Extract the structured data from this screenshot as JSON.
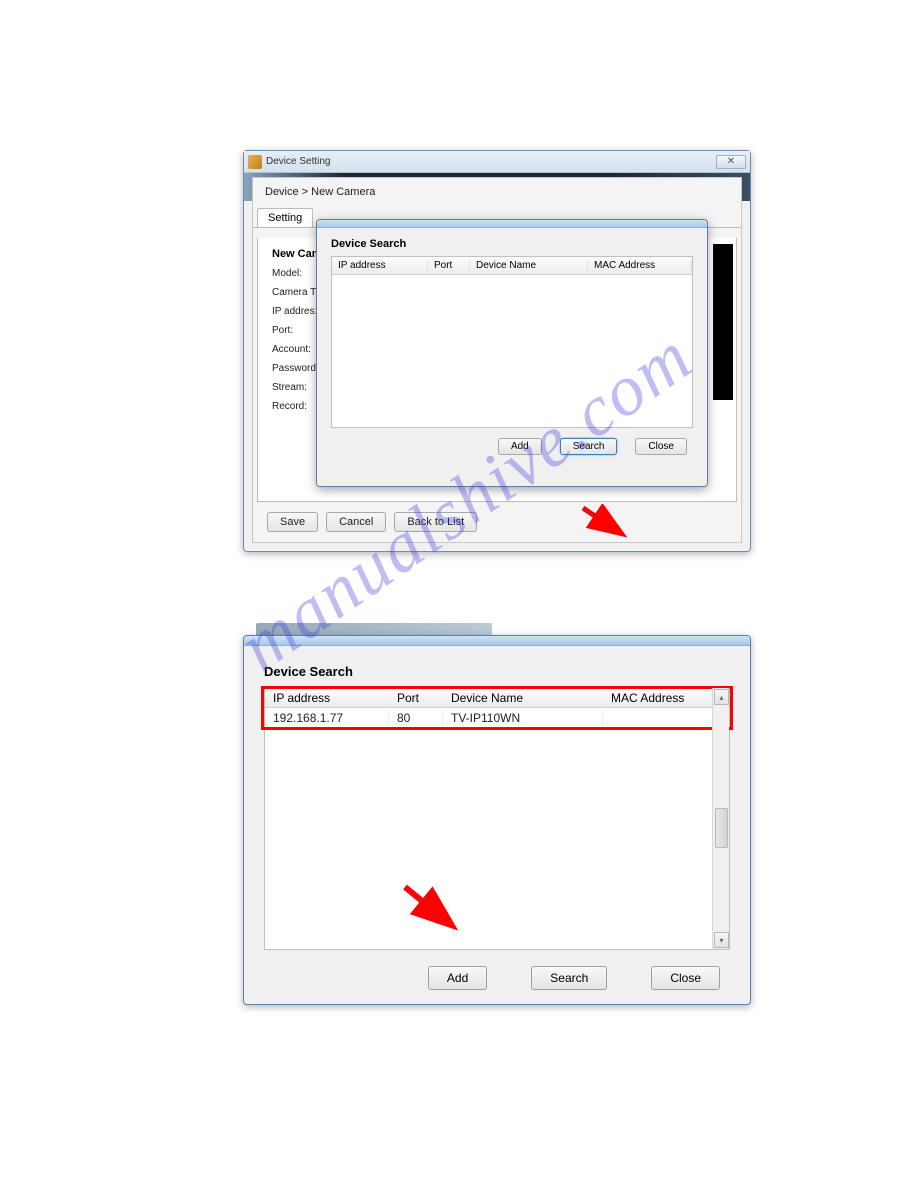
{
  "watermark": "manualshive.com",
  "win1": {
    "title": "Device Setting",
    "breadcrumb": "Device > New Camera",
    "tab": "Setting",
    "section": "New Cam",
    "labels": {
      "model": "Model:",
      "camera": "Camera T",
      "ip": "IP addres:",
      "port": "Port:",
      "account": "Account:",
      "password": "Password",
      "stream": "Stream:",
      "record": "Record:"
    },
    "buttons": {
      "save": "Save",
      "cancel": "Cancel",
      "back": "Back to List"
    }
  },
  "popup1": {
    "title": "Device Search",
    "columns": {
      "ip": "IP address",
      "port": "Port",
      "name": "Device Name",
      "mac": "MAC Address"
    },
    "buttons": {
      "add": "Add",
      "search": "Search",
      "close": "Close"
    }
  },
  "win2": {
    "title": "Device Search",
    "columns": {
      "ip": "IP address",
      "port": "Port",
      "name": "Device Name",
      "mac": "MAC Address"
    },
    "row": {
      "ip": "192.168.1.77",
      "port": "80",
      "name": "TV-IP110WN",
      "mac": ""
    },
    "buttons": {
      "add": "Add",
      "search": "Search",
      "close": "Close"
    }
  }
}
